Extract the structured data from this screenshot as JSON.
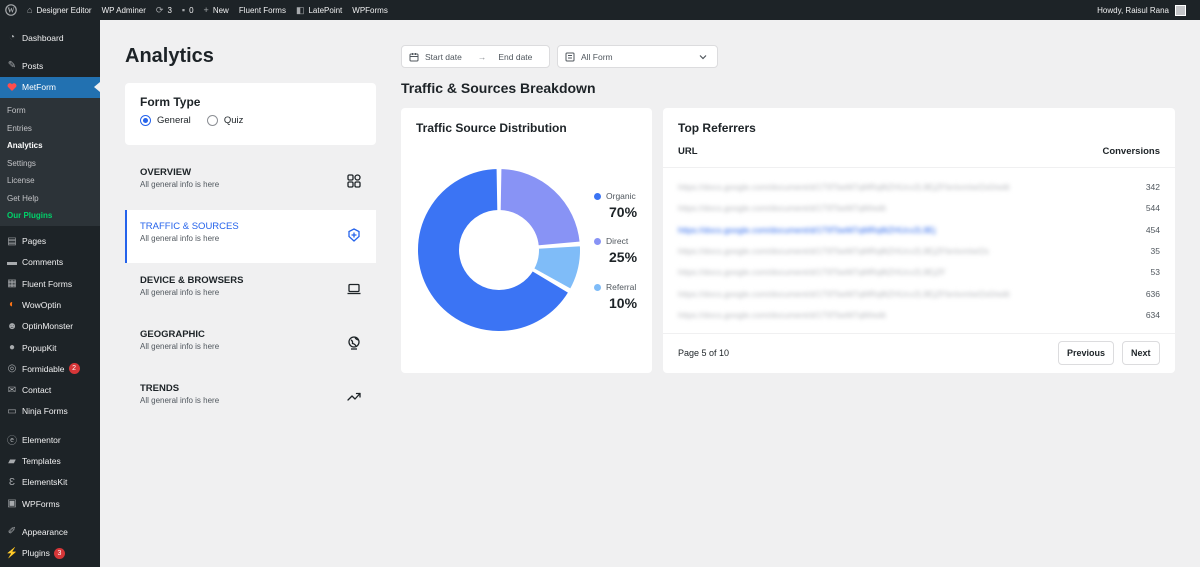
{
  "admin_bar": {
    "site_name": "Designer Editor",
    "wp_adminer": "WP Adminer",
    "updates_count": "3",
    "comments_count": "0",
    "new_label": "New",
    "fluent_forms": "Fluent Forms",
    "latepoint": "LatePoint",
    "wpforms": "WPForms",
    "howdy": "Howdy, Raisul Rana"
  },
  "sidebar": {
    "dashboard": "Dashboard",
    "posts": "Posts",
    "metform": "MetForm",
    "submenu": [
      "Form",
      "Entries",
      "Analytics",
      "Settings",
      "License",
      "Get Help",
      "Our Plugins"
    ],
    "items": [
      {
        "label": "Pages",
        "icon": "pages-icon"
      },
      {
        "label": "Comments",
        "icon": "comments-icon"
      },
      {
        "label": "Fluent Forms",
        "icon": "fluent-forms-icon"
      },
      {
        "label": "WowOptin",
        "icon": "wowoptin-icon"
      },
      {
        "label": "OptinMonster",
        "icon": "optinmonster-icon"
      },
      {
        "label": "PopupKit",
        "icon": "popupkit-icon"
      },
      {
        "label": "Formidable",
        "icon": "formidable-icon",
        "badge": "2"
      },
      {
        "label": "Contact",
        "icon": "contact-icon"
      },
      {
        "label": "Ninja Forms",
        "icon": "ninja-forms-icon"
      },
      {
        "label": "Elementor",
        "icon": "elementor-icon"
      },
      {
        "label": "Templates",
        "icon": "templates-icon"
      },
      {
        "label": "ElementsKit",
        "icon": "elementskit-icon"
      },
      {
        "label": "WPForms",
        "icon": "wpforms-icon"
      },
      {
        "label": "Appearance",
        "icon": "appearance-icon"
      },
      {
        "label": "Plugins",
        "icon": "plugins-icon",
        "badge": "3"
      }
    ]
  },
  "page": {
    "title": "Analytics",
    "form_type": {
      "title": "Form Type",
      "options": [
        "General",
        "Quiz"
      ],
      "selected": "General"
    },
    "nav": [
      {
        "title": "OVERVIEW",
        "subtitle": "All general info is here",
        "icon": "grid-icon",
        "active": false
      },
      {
        "title": "TRAFFIC & SOURCES",
        "subtitle": "All general info is here",
        "icon": "traffic-icon",
        "active": true
      },
      {
        "title": "DEVICE & BROWSERS",
        "subtitle": "All general info is here",
        "icon": "laptop-icon",
        "active": false
      },
      {
        "title": "GEOGRAPHIC",
        "subtitle": "All general info is here",
        "icon": "globe-icon",
        "active": false
      },
      {
        "title": "TRENDS",
        "subtitle": "All general info is here",
        "icon": "trend-icon",
        "active": false
      }
    ],
    "filters": {
      "start_date": "Start date",
      "end_date": "End date",
      "form_select": "All Form"
    },
    "section_heading": "Traffic & Sources Breakdown",
    "distribution_title": "Traffic Source Distribution",
    "referrers": {
      "title": "Top Referrers",
      "col_url": "URL",
      "col_conversions": "Conversions",
      "rows": [
        {
          "url": "https://docs.google.com/document/d/1T9TbeM7qMRq8tZHUcv2L9EjZFbnIxmIwI2s0/edit",
          "conversions": "342",
          "link": false
        },
        {
          "url": "https://docs.google.com/document/d/1T9TbeM7qM/edit",
          "conversions": "544",
          "link": false
        },
        {
          "url": "https://docs.google.com/document/d/1T9TbeM7qMRq8tZHUcv2L9Ej",
          "conversions": "454",
          "link": true
        },
        {
          "url": "https://docs.google.com/document/d/1T9TbeM7qMRq8tZHUcv2L9EjZFbnIxmIwI2s",
          "conversions": "35",
          "link": false
        },
        {
          "url": "https://docs.google.com/document/d/1T9TbeM7qMRq8tZHUcv2L9EjZF",
          "conversions": "53",
          "link": false
        },
        {
          "url": "https://docs.google.com/document/d/1T9TbeM7qMRq8tZHUcv2L9EjZFbnIxmIwI2s0/edit",
          "conversions": "636",
          "link": false
        },
        {
          "url": "https://docs.google.com/document/d/1T9TbeM7qM/edit",
          "conversions": "634",
          "link": false
        }
      ],
      "page_info": "Page 5 of 10",
      "prev_label": "Previous",
      "next_label": "Next"
    }
  },
  "colors": {
    "accent": "#2563eb",
    "wp_blue": "#2271b1",
    "sidebar_bg": "#1d2327",
    "organic": "#3b74f4",
    "direct": "#8893f5",
    "referral": "#7fbcf8"
  },
  "chart_data": {
    "type": "pie",
    "categories": [
      "Organic",
      "Direct",
      "Referral"
    ],
    "values": [
      70,
      25,
      10
    ],
    "value_labels": [
      "70%",
      "25%",
      "10%"
    ],
    "donut": true,
    "legend": "right",
    "colors": [
      "#3b74f4",
      "#8893f5",
      "#7fbcf8"
    ]
  }
}
